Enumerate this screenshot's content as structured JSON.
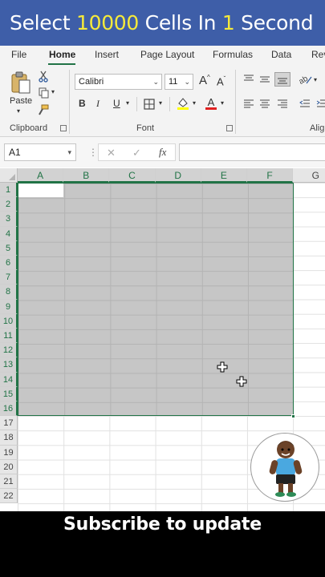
{
  "banner": {
    "part1": "Select ",
    "num1": "10000",
    "part2": " Cells In ",
    "num2": "1",
    "part3": " Second",
    "bg_color": "#3e5ea8",
    "highlight_color": "#f6ea3a"
  },
  "ribbon": {
    "tabs": [
      "File",
      "Home",
      "Insert",
      "Page Layout",
      "Formulas",
      "Data",
      "Rev"
    ],
    "active_tab": "Home",
    "accent_color": "#217346",
    "clipboard": {
      "paste_label": "Paste",
      "group_label": "Clipboard",
      "icons": [
        "paste-icon",
        "cut-icon",
        "copy-icon",
        "format-painter-icon"
      ]
    },
    "font": {
      "font_name": "Calibri",
      "font_size": "11",
      "group_label": "Font",
      "grow_label": "A",
      "shrink_label": "A",
      "bold": "B",
      "italic": "I",
      "underline": "U",
      "font_color_label": "A",
      "icons": [
        "borders-icon",
        "fill-color-icon",
        "font-color-icon"
      ]
    },
    "alignment": {
      "group_label": "Alig",
      "icons": [
        "align-top-icon",
        "align-middle-icon",
        "align-bottom-icon",
        "orientation-icon",
        "align-left-icon",
        "align-center-icon",
        "align-right-icon",
        "decrease-indent-icon",
        "increase-indent-icon"
      ]
    }
  },
  "formula_bar": {
    "name_box": "A1",
    "cancel": "✕",
    "enter": "✓",
    "fx": "fx",
    "value": ""
  },
  "sheet": {
    "columns": [
      "A",
      "B",
      "C",
      "D",
      "E",
      "F",
      "G"
    ],
    "rows": [
      "1",
      "2",
      "3",
      "4",
      "5",
      "6",
      "7",
      "8",
      "9",
      "10",
      "11",
      "12",
      "13",
      "14",
      "15",
      "16",
      "17",
      "18",
      "19",
      "20",
      "21",
      "22"
    ],
    "selection": "A1:F16",
    "active_cell": "A1"
  },
  "caption": {
    "text": "Subscribe to update"
  }
}
